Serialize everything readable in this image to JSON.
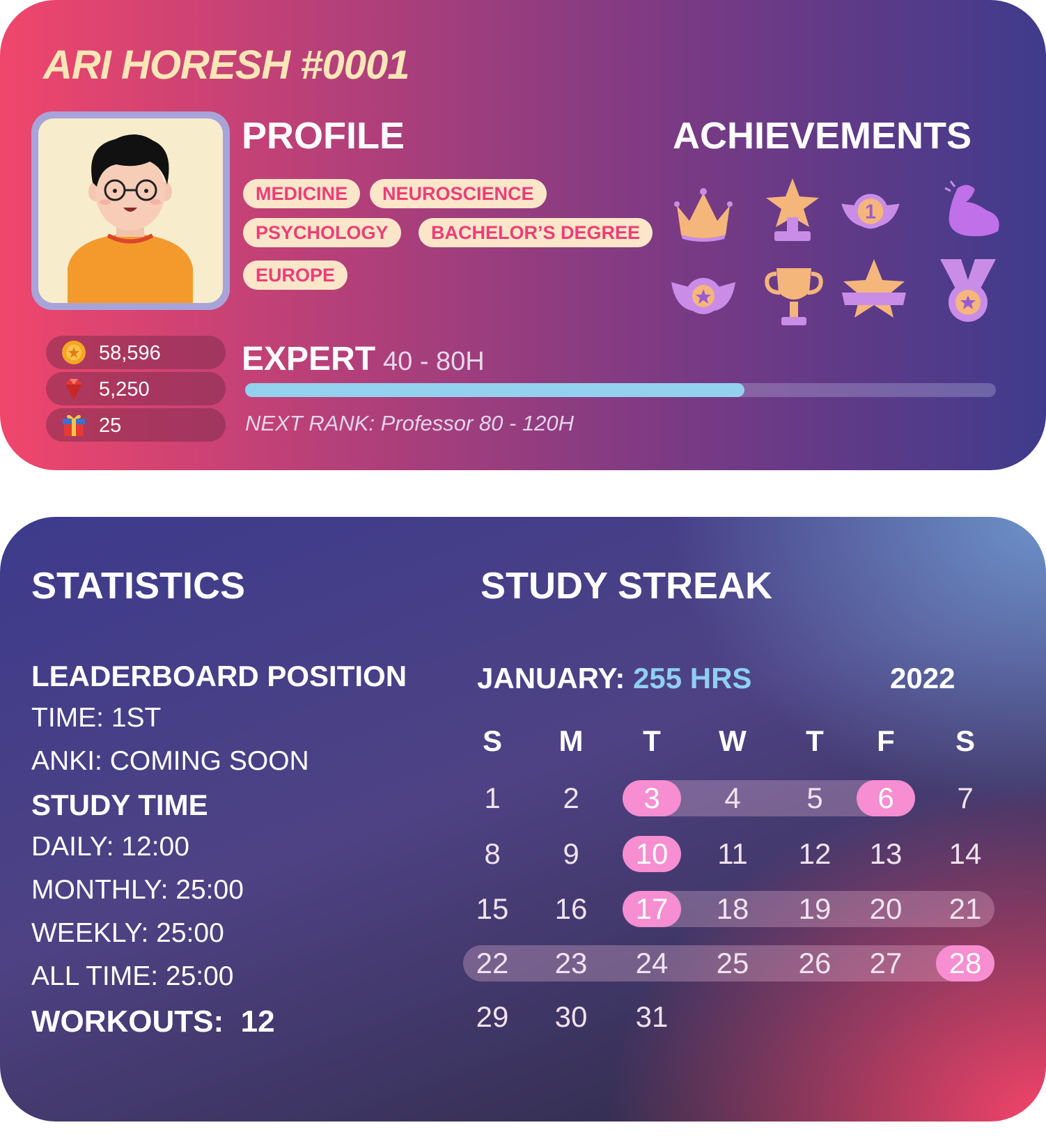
{
  "profile_card": {
    "user_title": "ARI HORESH #0001",
    "profile_heading": "PROFILE",
    "achievements_heading": "ACHIEVEMENTS",
    "tags": [
      "MEDICINE",
      "NEUROSCIENCE",
      "PSYCHOLOGY",
      "BACHELOR’S DEGREE",
      "EUROPE"
    ],
    "achievements": [
      "crown-icon",
      "star-trophy-icon",
      "winged-medal-1-icon",
      "flexed-arm-icon",
      "winged-star-badge-icon",
      "trophy-cup-icon",
      "star-ribbon-icon",
      "medal-icon"
    ],
    "currencies": [
      {
        "icon": "gold-coin-icon",
        "value": "58,596"
      },
      {
        "icon": "ruby-gem-icon",
        "value": "5,250"
      },
      {
        "icon": "gift-box-icon",
        "value": "25"
      }
    ],
    "rank": {
      "name": "EXPERT",
      "range": "40 - 80H",
      "progress": 0.665,
      "next": "NEXT RANK: Professor 80 - 120H"
    }
  },
  "stats_card": {
    "statistics_heading": "STATISTICS",
    "leaderboard_heading": "LEADERBOARD POSITION",
    "leaderboard_time": "TIME: 1ST",
    "leaderboard_anki": "ANKI: COMING SOON",
    "study_time_heading": "STUDY TIME",
    "daily": "DAILY: 12:00",
    "monthly": "MONTHLY: 25:00",
    "weekly": "WEEKLY: 25:00",
    "all_time": "ALL TIME: 25:00",
    "workouts_label": "WORKOUTS:",
    "workouts_value": "12"
  },
  "calendar": {
    "heading": "STUDY STREAK",
    "month": "JANUARY:",
    "hours": "255 HRS",
    "year": "2022",
    "weekdays": [
      "S",
      "M",
      "T",
      "W",
      "T",
      "F",
      "S"
    ],
    "weeks": [
      [
        "1",
        "2",
        "3",
        "4",
        "5",
        "6",
        "7"
      ],
      [
        "8",
        "9",
        "10",
        "11",
        "12",
        "13",
        "14"
      ],
      [
        "15",
        "16",
        "17",
        "18",
        "19",
        "20",
        "21"
      ],
      [
        "22",
        "23",
        "24",
        "25",
        "26",
        "27",
        "28"
      ],
      [
        "29",
        "30",
        "31",
        "",
        "",
        "",
        ""
      ]
    ],
    "highlighted_days": [
      "3",
      "6",
      "10",
      "17",
      "28"
    ],
    "streak_days": [
      "3",
      "4",
      "5",
      "6",
      "17",
      "18",
      "19",
      "20",
      "21",
      "22",
      "23",
      "24",
      "25",
      "26",
      "27",
      "28"
    ],
    "colors": {
      "highlight": "#f68ed1",
      "hours": "#8fd0f2",
      "progress": "#93d1ee"
    }
  }
}
